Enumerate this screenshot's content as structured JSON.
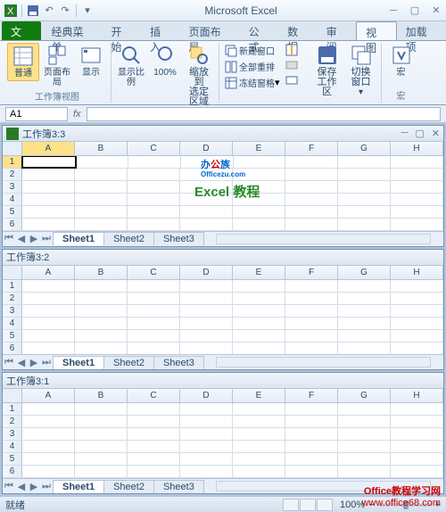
{
  "app": {
    "title": "Microsoft Excel"
  },
  "tabs": {
    "file": "文件",
    "items": [
      "经典菜单",
      "开始",
      "插入",
      "页面布局",
      "公式",
      "数据",
      "审阅",
      "视图",
      "加载项"
    ],
    "active": "视图"
  },
  "ribbon": {
    "group_views": {
      "label": "工作簿视图",
      "normal": "普通",
      "page_layout": "页面布局",
      "custom": "显示"
    },
    "group_show": {
      "label": "显示比例",
      "zoom": "显示比例",
      "hundred": "100%",
      "zoom_selection_l1": "缩放到",
      "zoom_selection_l2": "选定区域"
    },
    "group_window": {
      "new_window": "新建窗口",
      "arrange": "全部重排",
      "freeze": "冻结窗格",
      "save_ws_l1": "保存",
      "save_ws_l2": "工作区",
      "switch_l1": "切换窗口"
    },
    "group_macros": {
      "label": "宏",
      "macro": "宏"
    }
  },
  "namebox": {
    "cell": "A1"
  },
  "windows": [
    {
      "title": "工作簿3:3",
      "columns": [
        "A",
        "B",
        "C",
        "D",
        "E",
        "F",
        "G",
        "H"
      ],
      "rows": [
        1,
        2,
        3,
        4,
        5,
        6
      ],
      "sheets": [
        "Sheet1",
        "Sheet2",
        "Sheet3"
      ],
      "active_sheet": 0,
      "active_cell": true
    },
    {
      "title": "工作簿3:2",
      "columns": [
        "A",
        "B",
        "C",
        "D",
        "E",
        "F",
        "G",
        "H"
      ],
      "rows": [
        1,
        2,
        3,
        4,
        5,
        6
      ],
      "sheets": [
        "Sheet1",
        "Sheet2",
        "Sheet3"
      ],
      "active_sheet": 0,
      "active_cell": false
    },
    {
      "title": "工作簿3:1",
      "columns": [
        "A",
        "B",
        "C",
        "D",
        "E",
        "F",
        "G",
        "H"
      ],
      "rows": [
        1,
        2,
        3,
        4,
        5,
        6
      ],
      "sheets": [
        "Sheet1",
        "Sheet2",
        "Sheet3"
      ],
      "active_sheet": 0,
      "active_cell": false
    }
  ],
  "statusbar": {
    "ready": "就绪",
    "zoom": "100%"
  },
  "watermarks": {
    "officezu": {
      "text": "办公族",
      "sub": "Officezu.com"
    },
    "excel_tut": "Excel 教程",
    "footer_l1": "Office教程学习网",
    "footer_l2": "www.office68.com"
  }
}
